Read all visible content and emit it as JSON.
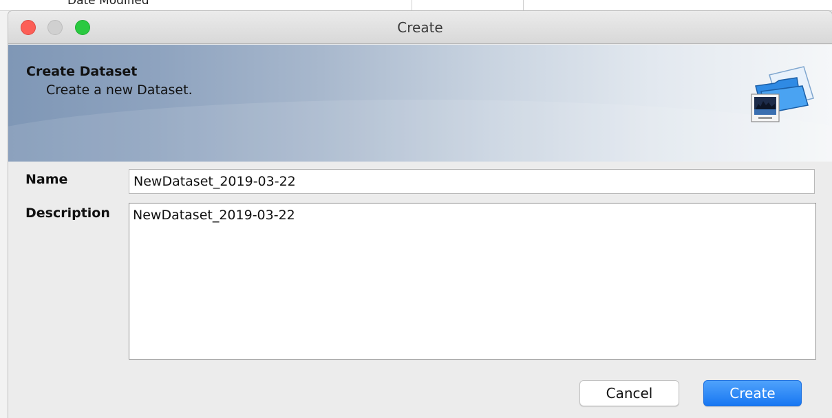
{
  "background": {
    "column_header": "Date Modified"
  },
  "window": {
    "title": "Create"
  },
  "banner": {
    "title": "Create Dataset",
    "subtitle": "Create a new Dataset.",
    "icon": "folder-image-icon"
  },
  "form": {
    "name_label": "Name",
    "name_value": "NewDataset_2019-03-22",
    "description_label": "Description",
    "description_value": "NewDataset_2019-03-22"
  },
  "buttons": {
    "cancel_label": "Cancel",
    "create_label": "Create"
  },
  "colors": {
    "close": "#fc5f57",
    "minimize": "#d0d0d0",
    "maximize": "#2ac940",
    "primary_button": "#1877f2"
  }
}
